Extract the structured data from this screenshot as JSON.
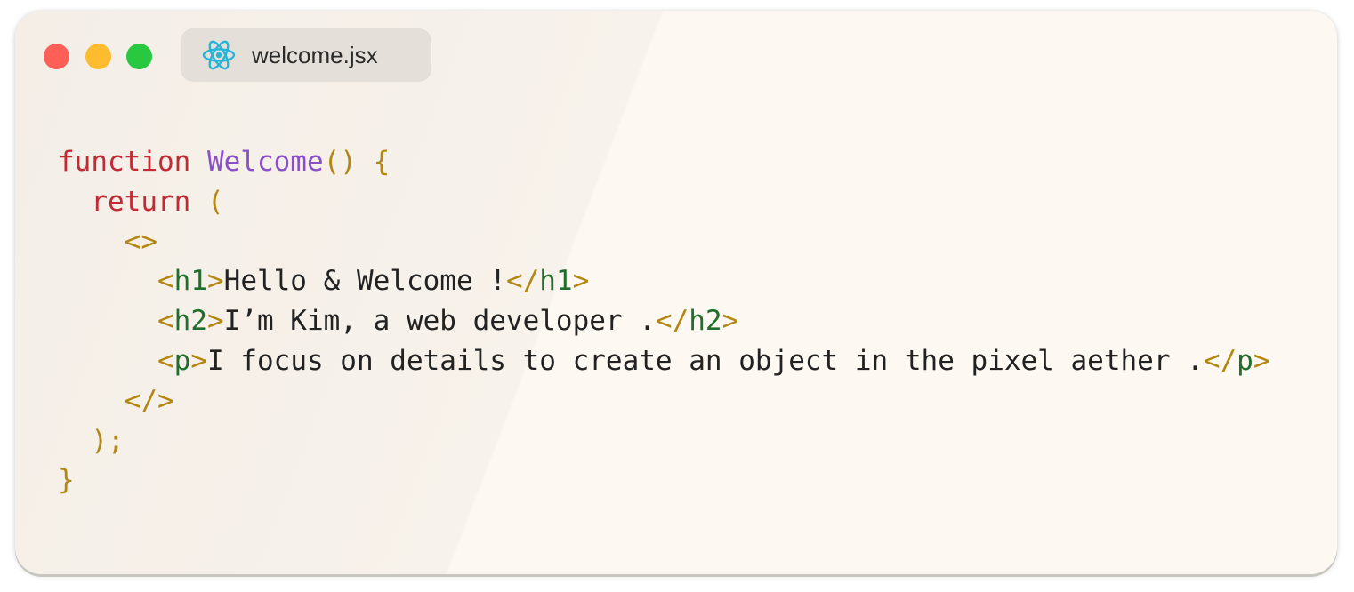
{
  "window": {
    "tab_label": "welcome.jsx",
    "tab_icon": "react-icon",
    "traffic_lights": {
      "close_color": "#ff5f57",
      "minimize_color": "#febc2e",
      "zoom_color": "#28c840"
    }
  },
  "colors": {
    "keyword": "#c22a34",
    "function_name": "#8a50c8",
    "punctuation": "#b3870f",
    "tag_name": "#1f6e2a",
    "text": "#222222",
    "react_icon": "#26b5d9"
  },
  "code": {
    "line1": {
      "kw": "function",
      "name": "Welcome",
      "punct": "() {"
    },
    "line2": {
      "kw": "return",
      "punct": "("
    },
    "line3": {
      "punct": "<>"
    },
    "line4": {
      "open_lt": "<",
      "open_tag": "h1",
      "open_gt": ">",
      "text": "Hello & Welcome !",
      "close_lt": "</",
      "close_tag": "h1",
      "close_gt": ">"
    },
    "line5": {
      "open_lt": "<",
      "open_tag": "h2",
      "open_gt": ">",
      "text": "I’m Kim, a web developer .",
      "close_lt": "</",
      "close_tag": "h2",
      "close_gt": ">"
    },
    "line6": {
      "open_lt": "<",
      "open_tag": "p",
      "open_gt": ">",
      "text": "I focus on details to create an object in the pixel aether .",
      "close_lt": "</",
      "close_tag": "p",
      "close_gt": ">"
    },
    "line7": {
      "punct": "</>"
    },
    "line8": {
      "punct": ");"
    },
    "line9": {
      "punct": "}"
    }
  }
}
